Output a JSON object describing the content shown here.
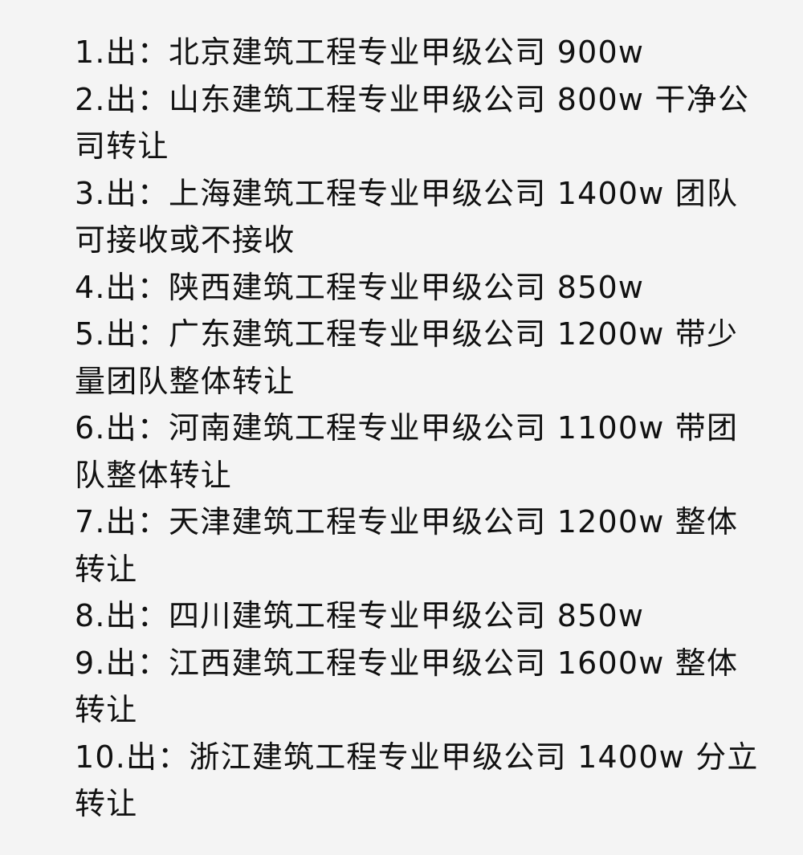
{
  "listings": [
    {
      "text": "1.出：北京建筑工程专业甲级公司 900w"
    },
    {
      "text": "2.出：山东建筑工程专业甲级公司 800w 干净公司转让"
    },
    {
      "text": "3.出：上海建筑工程专业甲级公司 1400w 团队可接收或不接收"
    },
    {
      "text": "4.出：陕西建筑工程专业甲级公司 850w"
    },
    {
      "text": "5.出：广东建筑工程专业甲级公司 1200w 带少量团队整体转让"
    },
    {
      "text": "6.出：河南建筑工程专业甲级公司 1100w 带团队整体转让"
    },
    {
      "text": "7.出：天津建筑工程专业甲级公司 1200w 整体转让"
    },
    {
      "text": "8.出：四川建筑工程专业甲级公司 850w"
    },
    {
      "text": "9.出：江西建筑工程专业甲级公司 1600w 整体转让"
    },
    {
      "text": "10.出：浙江建筑工程专业甲级公司 1400w 分立转让"
    }
  ]
}
